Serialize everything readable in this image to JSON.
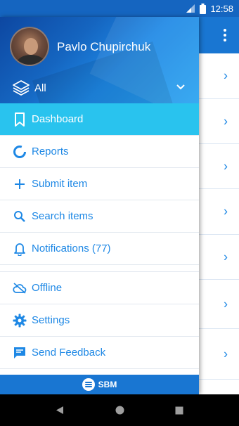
{
  "status_bar": {
    "time": "12:58"
  },
  "drawer": {
    "user_name": "Pavlo Chupirchuk",
    "account_selector": "All",
    "menu_primary": [
      {
        "label": "Dashboard",
        "icon": "bookmark-icon",
        "active": true
      },
      {
        "label": "Reports",
        "icon": "progress-circle-icon",
        "active": false
      },
      {
        "label": "Submit item",
        "icon": "plus-icon",
        "active": false
      },
      {
        "label": "Search items",
        "icon": "search-icon",
        "active": false
      },
      {
        "label": "Notifications (77)",
        "icon": "bell-icon",
        "active": false
      }
    ],
    "menu_secondary": [
      {
        "label": "Offline",
        "icon": "cloud-off-icon"
      },
      {
        "label": "Settings",
        "icon": "gear-icon"
      },
      {
        "label": "Send Feedback",
        "icon": "feedback-icon"
      }
    ],
    "footer_brand": "SBM"
  },
  "colors": {
    "accent": "#1e88e5",
    "active_item": "#29c3ee",
    "app_bar": "#1976d2",
    "status_bar": "#1565c0"
  }
}
